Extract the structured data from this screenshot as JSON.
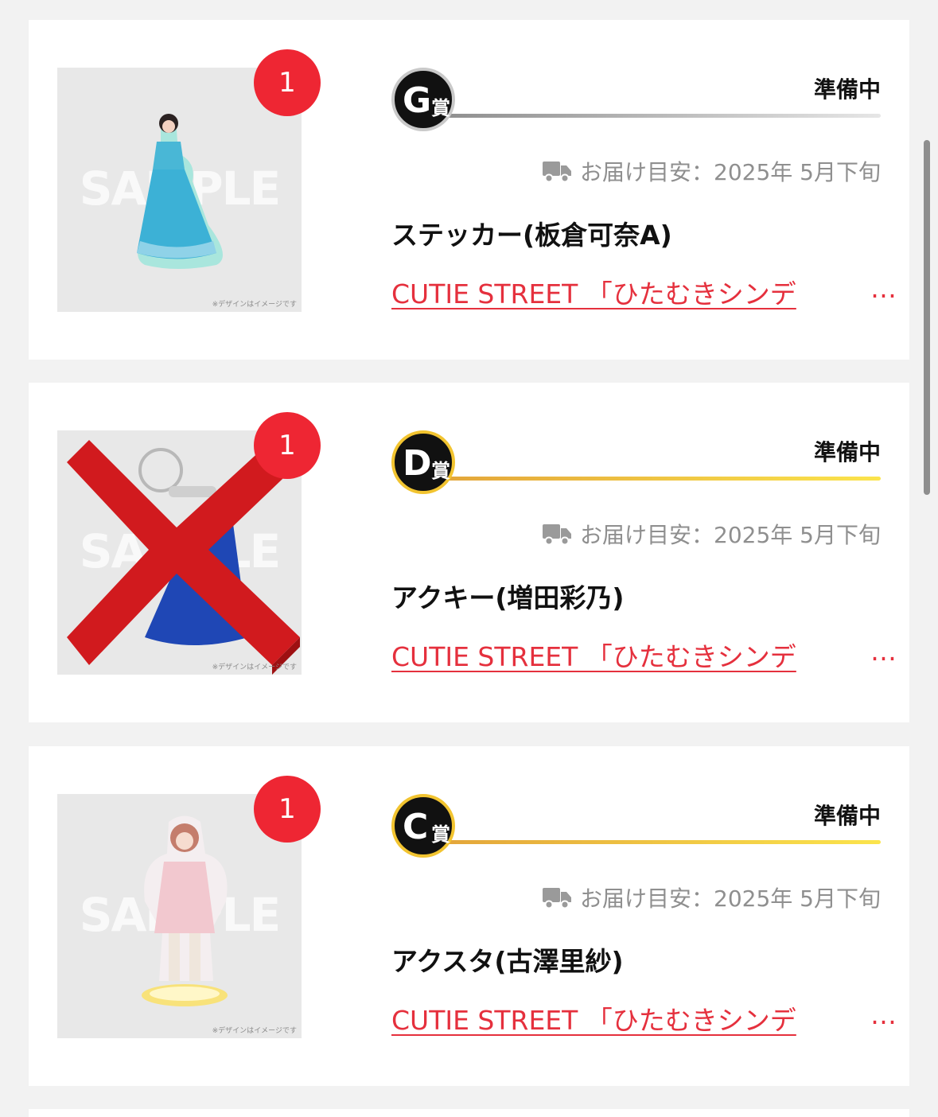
{
  "items": [
    {
      "count": "1",
      "prize_letter": "G",
      "prize_kanji": "賞",
      "status": "準備中",
      "delivery": "お届け目安：2025年 5月下旬",
      "name": "ステッカー(板倉可奈A)",
      "link": "CUTIE STREET 「ひたむきシンデ",
      "link_ellipsis": "…",
      "watermark": "SAMPLE",
      "caption": "※デザインはイメージです",
      "line_color": "#bdbdbd",
      "ring_color": "#c9c9c9",
      "crossed_out": false
    },
    {
      "count": "1",
      "prize_letter": "D",
      "prize_kanji": "賞",
      "status": "準備中",
      "delivery": "お届け目安：2025年 5月下旬",
      "name": "アクキー(増田彩乃)",
      "link": "CUTIE STREET 「ひたむきシンデ",
      "link_ellipsis": "…",
      "watermark": "SAMPLE",
      "caption": "※デザインはイメージです",
      "line_color": "#f2c430",
      "ring_color": "#f2c430",
      "crossed_out": true
    },
    {
      "count": "1",
      "prize_letter": "C",
      "prize_kanji": "賞",
      "status": "準備中",
      "delivery": "お届け目安：2025年 5月下旬",
      "name": "アクスタ(古澤里紗)",
      "link": "CUTIE STREET 「ひたむきシンデ",
      "link_ellipsis": "…",
      "watermark": "SAMPLE",
      "caption": "※デザインはイメージです",
      "line_color": "#f2c430",
      "ring_color": "#f2c430",
      "crossed_out": false
    }
  ],
  "icons": {
    "truck": "truck-icon"
  },
  "colors": {
    "badge": "#ee2633",
    "link": "#e5303d",
    "cross": "#d11a1e"
  }
}
